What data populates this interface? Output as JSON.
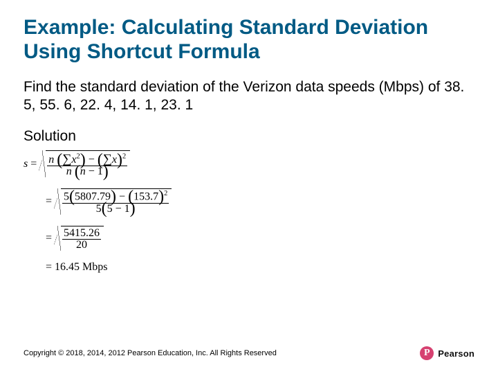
{
  "title": "Example: Calculating Standard Deviation Using Shortcut Formula",
  "prompt": "Find the standard deviation of the Verizon data speeds (Mbps) of 38. 5, 55. 6, 22. 4, 14. 1, 23. 1",
  "solution_label": "Solution",
  "math": {
    "s_var": "s",
    "eq": "=",
    "n": "n",
    "minus1": "1",
    "sum_sym": "∑",
    "x": "x",
    "sq": "2",
    "lp": "(",
    "rp": ")",
    "minus": "−",
    "step2": {
      "n_val": "5",
      "sum_x2": "5807.79",
      "sum_x": "153.7",
      "den_nm1": "5 − 1"
    },
    "step3": {
      "num": "5415.26",
      "den": "20"
    },
    "result_val": "16.45",
    "result_unit": "Mbps"
  },
  "copyright": "Copyright © 2018, 2014, 2012 Pearson Education, Inc. All Rights Reserved",
  "logo": {
    "initial": "P",
    "name": "Pearson"
  }
}
